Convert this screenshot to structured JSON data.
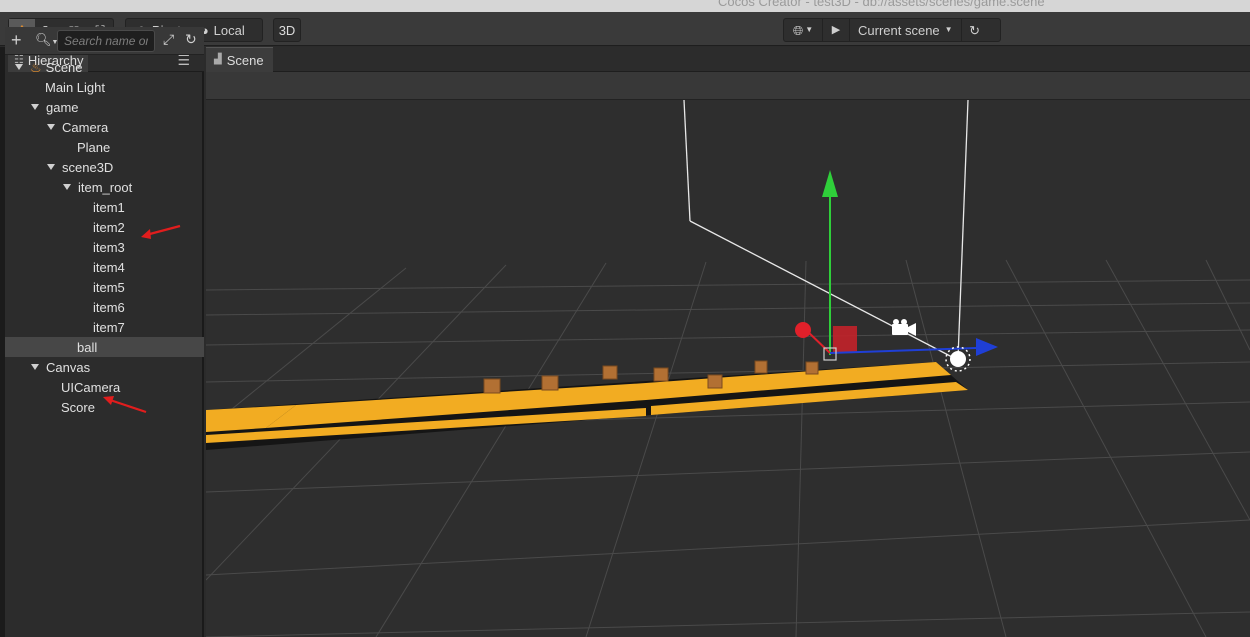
{
  "window": {
    "title": "Cocos Creator - test3D - db://assets/scenes/game.scene"
  },
  "toolbar": {
    "pivot_label": "Pivot",
    "local_label": "Local",
    "mode_3d_label": "3D",
    "scene_select_label": "Current scene"
  },
  "hierarchy": {
    "tab_label": "Hierarchy",
    "search_placeholder": "Search name or uuid",
    "nodes": [
      {
        "label": "Scene"
      },
      {
        "label": "Main Light"
      },
      {
        "label": "game"
      },
      {
        "label": "Camera"
      },
      {
        "label": "Plane"
      },
      {
        "label": "scene3D"
      },
      {
        "label": "item_root"
      },
      {
        "label": "item1"
      },
      {
        "label": "item2"
      },
      {
        "label": "item3"
      },
      {
        "label": "item4"
      },
      {
        "label": "item5"
      },
      {
        "label": "item6"
      },
      {
        "label": "item7"
      },
      {
        "label": "ball"
      },
      {
        "label": "Canvas"
      },
      {
        "label": "UICamera"
      },
      {
        "label": "Score"
      }
    ],
    "selected": "ball"
  },
  "scene_panel": {
    "tab_label": "Scene"
  },
  "colors": {
    "accent_orange": "#e8912d",
    "track_yellow": "#f2ac22",
    "annotation_red": "#e11d1d",
    "gizmo_green": "#2fcf3a",
    "gizmo_blue": "#1f3fd6",
    "gizmo_red": "#e0202a"
  }
}
